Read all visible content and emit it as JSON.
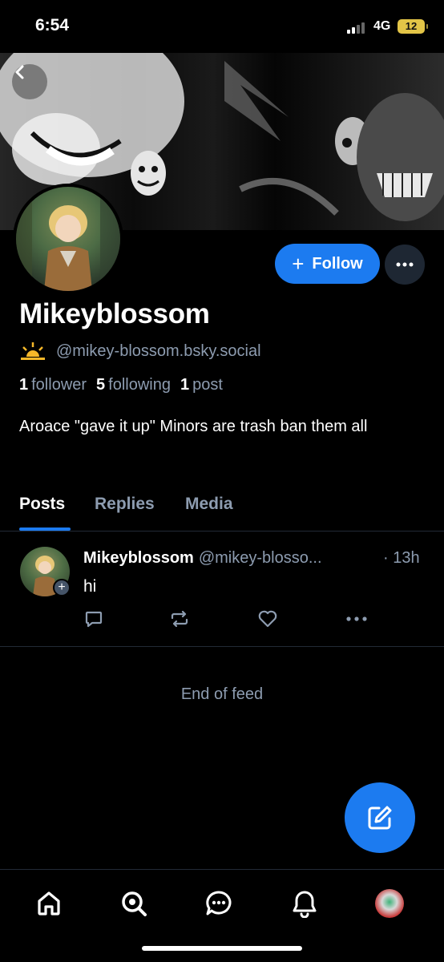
{
  "status_bar": {
    "time": "6:54",
    "network": "4G",
    "battery": "12"
  },
  "profile": {
    "display_name": "Mikeyblossom",
    "handle": "@mikey-blossom.bsky.social",
    "stats": {
      "followers_count": "1",
      "followers_label": "follower",
      "following_count": "5",
      "following_label": "following",
      "posts_count": "1",
      "posts_label": "post"
    },
    "bio": "Aroace \"gave it up\" Minors are trash ban them all"
  },
  "buttons": {
    "follow_label": "Follow",
    "follow_icon": "plus-icon"
  },
  "tabs": [
    {
      "label": "Posts",
      "active": true
    },
    {
      "label": "Replies",
      "active": false
    },
    {
      "label": "Media",
      "active": false
    }
  ],
  "post": {
    "author_name": "Mikeyblossom",
    "author_handle": "@mikey-blosso...",
    "time": "· 13h",
    "text": "hi",
    "actions": [
      "reply-icon",
      "repost-icon",
      "like-icon",
      "more-icon"
    ]
  },
  "feed": {
    "end_label": "End of feed"
  },
  "nav": [
    "home-icon",
    "search-icon",
    "chat-icon",
    "notifications-icon",
    "profile-avatar"
  ],
  "colors": {
    "accent": "#1c7bf0",
    "muted_text": "#8d9cb0",
    "background": "#000000",
    "battery": "#e3c547"
  }
}
